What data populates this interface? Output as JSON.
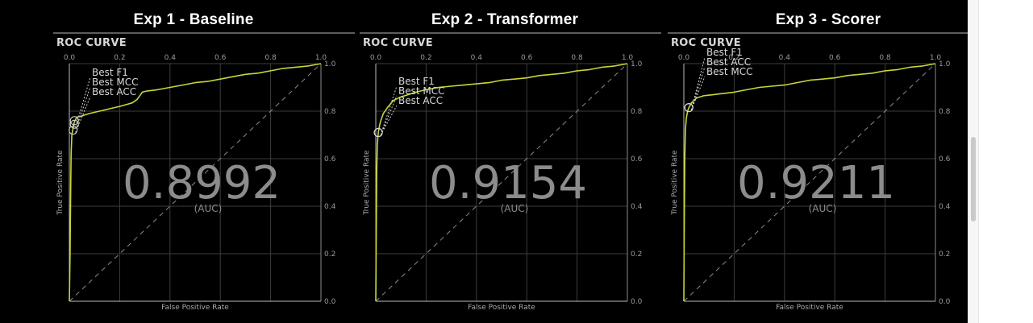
{
  "chart_data": [
    {
      "type": "line",
      "experiment_title": "Exp 1 - Baseline",
      "title": "ROC CURVE",
      "xlabel": "False Positive Rate",
      "ylabel": "True Positive Rate",
      "xlim": [
        0,
        1
      ],
      "ylim": [
        0,
        1
      ],
      "xticks": [
        "0.0",
        "0.2",
        "0.4",
        "0.6",
        "0.8",
        "1.0"
      ],
      "yticks": [
        "0.0",
        "0.2",
        "0.4",
        "0.6",
        "0.8",
        "1.0"
      ],
      "grid": true,
      "auc": "0.8992",
      "auc_label": "(AUC)",
      "colors": {
        "curve": "#c9d636",
        "grid": "#3c3c3c",
        "diagonal": "#8a8a8a",
        "auc": "#8c8c8c"
      },
      "markers": [
        {
          "label": "Best F1",
          "x": 0.02,
          "y": 0.76
        },
        {
          "label": "Best MCC",
          "x": 0.02,
          "y": 0.745
        },
        {
          "label": "Best ACC",
          "x": 0.015,
          "y": 0.72
        }
      ],
      "series": [
        {
          "x": [
            0,
            0.003,
            0.005,
            0.007,
            0.01,
            0.015,
            0.02,
            0.03,
            0.05,
            0.08,
            0.12,
            0.16,
            0.2,
            0.25,
            0.27,
            0.29,
            0.31,
            0.35,
            0.4,
            0.45,
            0.5,
            0.55,
            0.6,
            0.65,
            0.7,
            0.75,
            0.8,
            0.85,
            0.9,
            0.95,
            1.0
          ],
          "y": [
            0,
            0.2,
            0.45,
            0.62,
            0.7,
            0.73,
            0.755,
            0.775,
            0.78,
            0.79,
            0.8,
            0.81,
            0.82,
            0.835,
            0.85,
            0.88,
            0.885,
            0.89,
            0.9,
            0.91,
            0.92,
            0.925,
            0.935,
            0.945,
            0.955,
            0.96,
            0.97,
            0.98,
            0.985,
            0.99,
            1.0
          ]
        }
      ]
    },
    {
      "type": "line",
      "experiment_title": "Exp 2 - Transformer",
      "title": "ROC CURVE",
      "xlabel": "False Positive Rate",
      "ylabel": "True Positive Rate",
      "xlim": [
        0,
        1
      ],
      "ylim": [
        0,
        1
      ],
      "xticks": [
        "0.0",
        "0.2",
        "0.4",
        "0.6",
        "0.8",
        "1.0"
      ],
      "yticks": [
        "0.0",
        "0.2",
        "0.4",
        "0.6",
        "0.8",
        "1.0"
      ],
      "grid": true,
      "auc": "0.9154",
      "auc_label": "(AUC)",
      "colors": {
        "curve": "#c9d636",
        "grid": "#3c3c3c",
        "diagonal": "#8a8a8a",
        "auc": "#8c8c8c"
      },
      "markers": [
        {
          "label": "Best F1",
          "x": 0.01,
          "y": 0.71
        },
        {
          "label": "Best MCC",
          "x": 0.01,
          "y": 0.71
        },
        {
          "label": "Best ACC",
          "x": 0.01,
          "y": 0.71
        }
      ],
      "series": [
        {
          "x": [
            0,
            0.002,
            0.004,
            0.006,
            0.01,
            0.015,
            0.02,
            0.03,
            0.05,
            0.07,
            0.1,
            0.13,
            0.16,
            0.2,
            0.25,
            0.3,
            0.35,
            0.4,
            0.45,
            0.5,
            0.55,
            0.6,
            0.65,
            0.7,
            0.75,
            0.8,
            0.85,
            0.9,
            0.95,
            1.0
          ],
          "y": [
            0,
            0.3,
            0.55,
            0.66,
            0.71,
            0.74,
            0.76,
            0.79,
            0.82,
            0.845,
            0.86,
            0.87,
            0.88,
            0.89,
            0.9,
            0.905,
            0.91,
            0.915,
            0.92,
            0.93,
            0.935,
            0.94,
            0.95,
            0.955,
            0.96,
            0.97,
            0.975,
            0.985,
            0.99,
            1.0
          ]
        }
      ]
    },
    {
      "type": "line",
      "experiment_title": "Exp 3 - Scorer",
      "title": "ROC CURVE",
      "xlabel": "False Positive Rate",
      "ylabel": "True Positive Rate",
      "xlim": [
        0,
        1
      ],
      "ylim": [
        0,
        1
      ],
      "xticks": [
        "0.0",
        "0.2",
        "0.4",
        "0.6",
        "0.8",
        "1.0"
      ],
      "yticks": [
        "0.0",
        "0.2",
        "0.4",
        "0.6",
        "0.8",
        "1.0"
      ],
      "grid": true,
      "auc": "0.9211",
      "auc_label": "(AUC)",
      "colors": {
        "curve": "#c9d636",
        "grid": "#3c3c3c",
        "diagonal": "#8a8a8a",
        "auc": "#8c8c8c"
      },
      "markers": [
        {
          "label": "Best F1",
          "x": 0.02,
          "y": 0.815
        },
        {
          "label": "Best ACC",
          "x": 0.02,
          "y": 0.815
        },
        {
          "label": "Best MCC",
          "x": 0.02,
          "y": 0.815
        }
      ],
      "series": [
        {
          "x": [
            0,
            0.002,
            0.004,
            0.006,
            0.01,
            0.015,
            0.02,
            0.03,
            0.05,
            0.08,
            0.12,
            0.16,
            0.2,
            0.25,
            0.3,
            0.35,
            0.4,
            0.45,
            0.5,
            0.55,
            0.6,
            0.65,
            0.7,
            0.75,
            0.8,
            0.85,
            0.9,
            0.95,
            1.0
          ],
          "y": [
            0,
            0.35,
            0.6,
            0.72,
            0.77,
            0.8,
            0.815,
            0.835,
            0.855,
            0.865,
            0.87,
            0.875,
            0.88,
            0.89,
            0.9,
            0.905,
            0.91,
            0.92,
            0.93,
            0.935,
            0.94,
            0.95,
            0.955,
            0.96,
            0.97,
            0.975,
            0.985,
            0.99,
            1.0
          ]
        }
      ]
    }
  ]
}
